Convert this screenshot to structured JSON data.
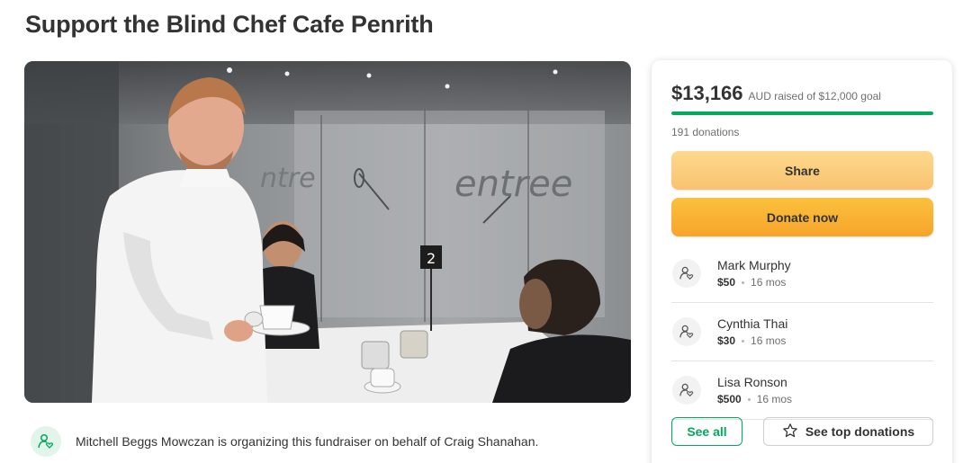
{
  "page": {
    "title": "Support the Blind Chef Cafe Penrith"
  },
  "hero": {
    "window_text": "entree",
    "table_number": "2"
  },
  "organizer": {
    "icon": "heart-person-icon",
    "text": "Mitchell Beggs Mowczan is organizing this fundraiser on behalf of Craig Shanahan."
  },
  "fundraiser": {
    "amount_raised": "$13,166",
    "goal_text": "AUD raised of $12,000 goal",
    "progress_fraction": 1.0,
    "donations_count": "191 donations",
    "share_label": "Share",
    "donate_label": "Donate now",
    "see_all_label": "See all",
    "top_donations_label": "See top donations"
  },
  "donations": [
    {
      "name": "Mark Murphy",
      "amount": "$50",
      "time": "16 mos"
    },
    {
      "name": "Cynthia Thai",
      "amount": "$30",
      "time": "16 mos"
    },
    {
      "name": "Lisa Ronson",
      "amount": "$500",
      "time": "16 mos"
    }
  ],
  "colors": {
    "accent_green": "#02a95c",
    "share_button": "#fcd084",
    "donate_button": "#f9b233"
  }
}
